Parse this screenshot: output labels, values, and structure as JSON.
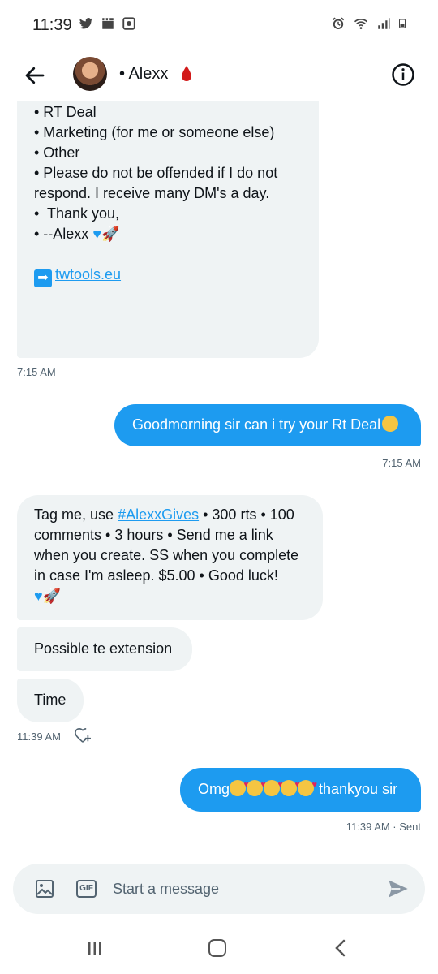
{
  "status_bar": {
    "time": "11:39"
  },
  "header": {
    "name": "• Alexx"
  },
  "messages": {
    "first": {
      "lines": [
        "• RT Deal",
        "• Marketing (for me or someone else)",
        "• Other",
        "",
        "• Please do not be offended if I do not",
        "respond. I receive many DM's a day.",
        "",
        "•  Thank you,",
        "",
        "• --Alexx"
      ],
      "link": "twtools.eu",
      "time": "7:15 AM"
    },
    "outgoing1": {
      "text": "Goodmorning sir can i try your Rt Deal",
      "time": "7:15 AM"
    },
    "incoming2": {
      "prefix": "Tag me, use ",
      "hashtag": "#AlexxGives",
      "rest1": " • 300 rts • 100",
      "line2": "comments • 3 hours • Send me a link",
      "line3": "when you create. SS when you complete",
      "line4": "in case I'm asleep. $5.00 • Good luck!"
    },
    "incoming3": {
      "text": "Possible te extension"
    },
    "incoming4": {
      "text": "Time",
      "time": "11:39 AM"
    },
    "outgoing2": {
      "prefix": "Omg",
      "suffix": " thankyou sir",
      "time": "11:39 AM · Sent"
    }
  },
  "composer": {
    "placeholder": "Start a message",
    "gif_label": "GIF"
  },
  "colors": {
    "accent": "#1d9bf0",
    "bubble_in": "#eff3f4",
    "meta": "#536471"
  },
  "icons": {
    "back": "arrow-left-icon",
    "info": "info-icon",
    "image": "image-icon",
    "gif": "gif-icon",
    "send": "send-icon",
    "react": "heart-plus-icon"
  }
}
